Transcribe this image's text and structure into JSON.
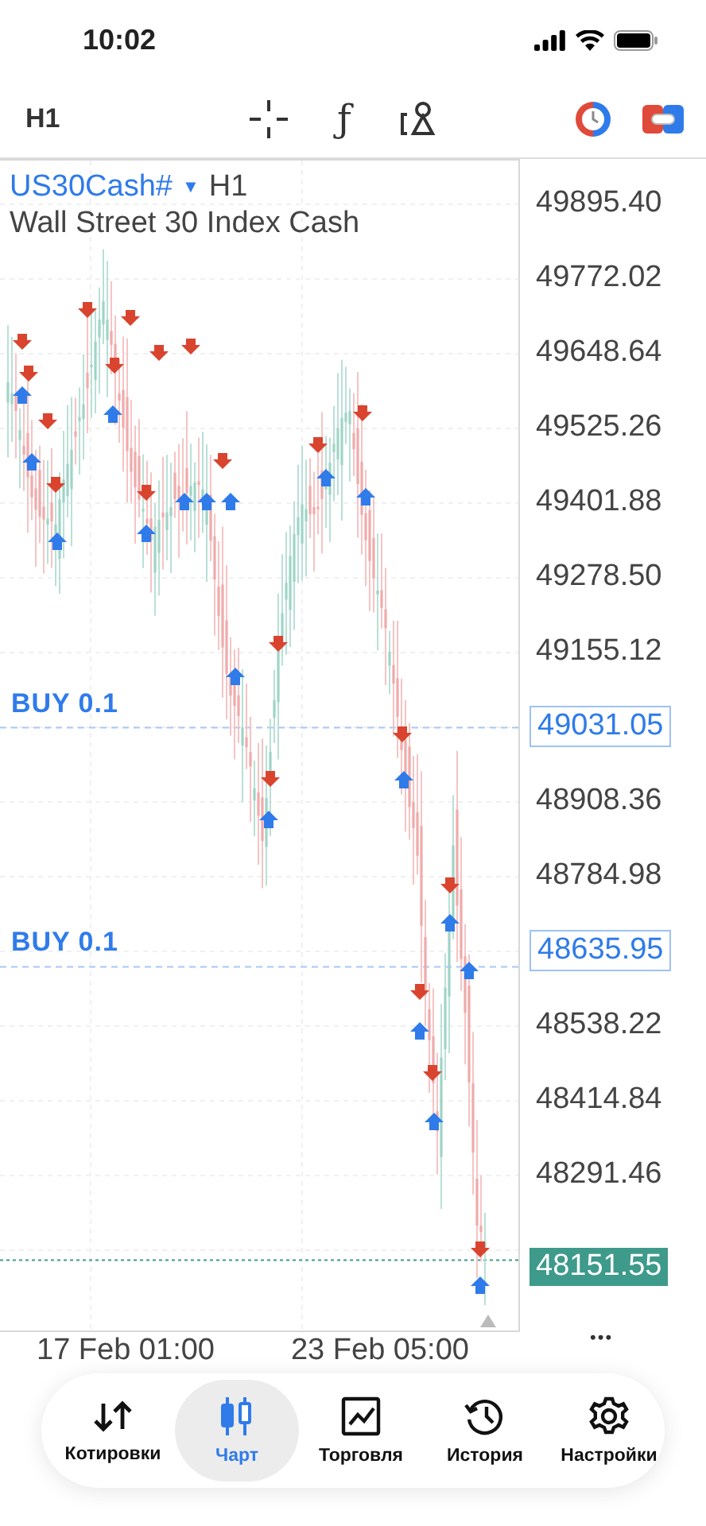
{
  "status_bar": {
    "time": "10:02"
  },
  "toolbar": {
    "timeframe": "H1",
    "function_glyph": "ƒ"
  },
  "chart": {
    "symbol": "US30Cash#",
    "caret": "▼",
    "timeframe": "H1",
    "description": "Wall Street 30 Index Cash",
    "order_lines": [
      {
        "label": "BUY 0.1"
      },
      {
        "label": "BUY 0.1"
      }
    ],
    "price_axis": [
      {
        "kind": "tick",
        "text": "49895.40"
      },
      {
        "kind": "tick",
        "text": "49772.02"
      },
      {
        "kind": "tick",
        "text": "49648.64"
      },
      {
        "kind": "tick",
        "text": "49525.26"
      },
      {
        "kind": "tick",
        "text": "49401.88"
      },
      {
        "kind": "tick",
        "text": "49278.50"
      },
      {
        "kind": "tick",
        "text": "49155.12"
      },
      {
        "kind": "order",
        "text": "49031.05"
      },
      {
        "kind": "tick",
        "text": "48908.36"
      },
      {
        "kind": "tick",
        "text": "48784.98"
      },
      {
        "kind": "order",
        "text": "48635.95"
      },
      {
        "kind": "tick",
        "text": "48538.22"
      },
      {
        "kind": "tick",
        "text": "48414.84"
      },
      {
        "kind": "tick",
        "text": "48291.46"
      },
      {
        "kind": "current",
        "text": "48151.55"
      }
    ],
    "more": "•••",
    "time_axis": [
      "17 Feb 01:00",
      "23 Feb 05:00"
    ]
  },
  "nav": [
    {
      "label": "Котировки",
      "selected": false
    },
    {
      "label": "Чарт",
      "selected": true
    },
    {
      "label": "Торговля",
      "selected": false
    },
    {
      "label": "История",
      "selected": false
    },
    {
      "label": "Настройки",
      "selected": false
    }
  ]
}
